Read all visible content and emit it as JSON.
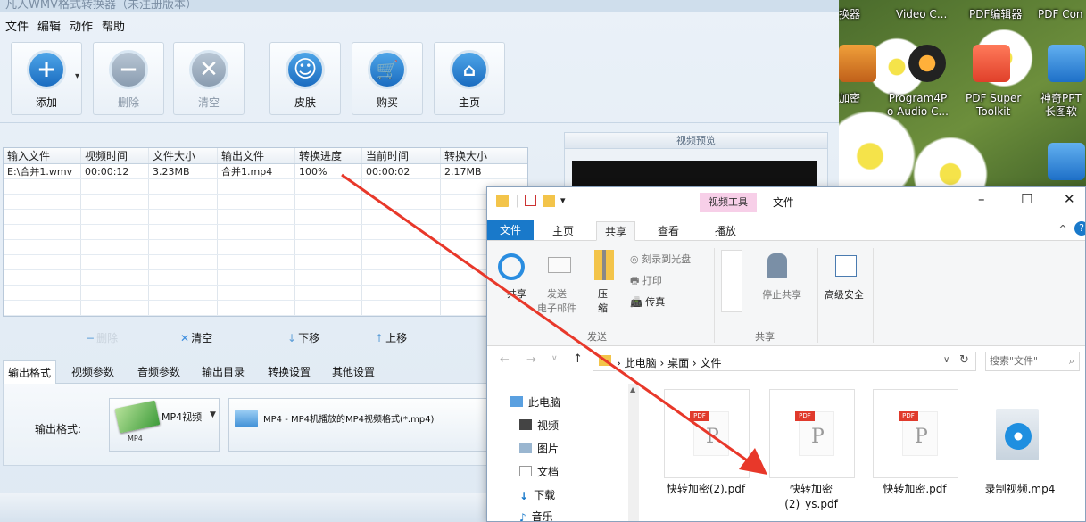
{
  "app": {
    "title_partial": "凡人WMV格式转换器（未注册版本）",
    "menu": [
      "文件",
      "编辑",
      "动作",
      "帮助"
    ],
    "toolbar": {
      "add": "添加",
      "delete": "删除",
      "clear": "清空",
      "skin": "皮肤",
      "buy": "购买",
      "home": "主页"
    },
    "table": {
      "headers": [
        "输入文件",
        "视频时间",
        "文件大小",
        "输出文件",
        "转换进度",
        "当前时间",
        "转换大小"
      ],
      "rows": [
        [
          "E:\\合并1.wmv",
          "00:00:12",
          "3.23MB",
          "合并1.mp4",
          "100%",
          "00:00:02",
          "2.17MB"
        ]
      ]
    },
    "list_actions": {
      "delete": "删除",
      "clear": "清空",
      "down": "下移",
      "up": "上移"
    },
    "settings_tabs": [
      "输出格式",
      "视频参数",
      "音频参数",
      "输出目录",
      "转换设置",
      "其他设置"
    ],
    "output_format": {
      "label": "输出格式:",
      "short": "MP4视频",
      "tag": "MP4",
      "description": "MP4 - MP4机播放的MP4视频格式(*.mp4)"
    },
    "preview_title": "视频预览"
  },
  "desktop": {
    "top_labels": [
      "换器",
      "Video C...",
      "PDF编辑器",
      "PDF Con"
    ],
    "icons": [
      {
        "label": "加密",
        "icon": "lock-icon"
      },
      {
        "label": "Program4P\no Audio C...",
        "icon": "music-icon"
      },
      {
        "label": "PDF Super\nToolkit",
        "icon": "pdf-icon"
      },
      {
        "label": "神奇PPT\n长图软",
        "icon": "ppt-icon"
      }
    ]
  },
  "explorer": {
    "context_tab": "视频工具",
    "window_name": "文件",
    "ribbon_tabs": [
      "文件",
      "主页",
      "共享",
      "查看",
      "播放"
    ],
    "ribbon": {
      "share": "共享",
      "email": "发送\n电子邮件",
      "zip": "压\n缩",
      "burn": "刻录到光盘",
      "print": "打印",
      "fax": "传真",
      "send_group": "发送",
      "stop_share": "停止共享",
      "adv_security": "高级安全",
      "share_group": "共享"
    },
    "breadcrumb": [
      "此电脑",
      "桌面",
      "文件"
    ],
    "search_placeholder": "搜索\"文件\"",
    "nav": [
      "此电脑",
      "视频",
      "图片",
      "文档",
      "下载",
      "音乐"
    ],
    "files": [
      "快转加密(2).pdf",
      "快转加密\n(2)_ys.pdf",
      "快转加密.pdf",
      "录制视频.mp4"
    ],
    "pdf_tag": "PDF"
  },
  "colors": {
    "accent_blue": "#1979ca",
    "arrow_red": "#e8382a",
    "context_pink": "#f7cfe8"
  }
}
